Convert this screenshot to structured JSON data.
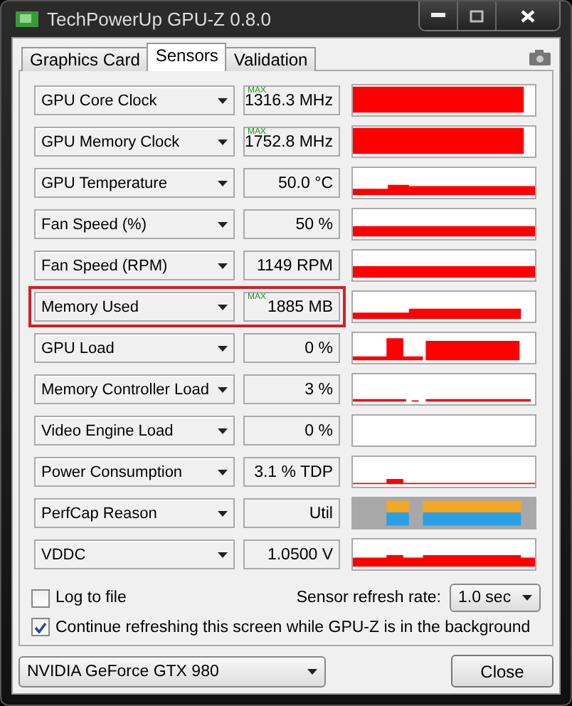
{
  "window": {
    "title": "TechPowerUp GPU-Z 0.8.0"
  },
  "tabs": [
    {
      "label": "Graphics Card",
      "selected": false
    },
    {
      "label": "Sensors",
      "selected": true
    },
    {
      "label": "Validation",
      "selected": false
    }
  ],
  "sensors": [
    {
      "name": "GPU Core Clock",
      "max_label": "MAX",
      "value": "1316.3 MHz",
      "highlighted": false,
      "kind": "line"
    },
    {
      "name": "GPU Memory Clock",
      "max_label": "MAX",
      "value": "1752.8 MHz",
      "highlighted": false,
      "kind": "line"
    },
    {
      "name": "GPU Temperature",
      "value": "50.0 °C",
      "highlighted": false,
      "kind": "line"
    },
    {
      "name": "Fan Speed (%)",
      "value": "50 %",
      "highlighted": false,
      "kind": "line"
    },
    {
      "name": "Fan Speed (RPM)",
      "value": "1149 RPM",
      "highlighted": false,
      "kind": "line"
    },
    {
      "name": "Memory Used",
      "max_label": "MAX",
      "value": "1885 MB",
      "highlighted": true,
      "kind": "line"
    },
    {
      "name": "GPU Load",
      "value": "0 %",
      "highlighted": false,
      "kind": "line"
    },
    {
      "name": "Memory Controller Load",
      "value": "3 %",
      "highlighted": false,
      "kind": "line"
    },
    {
      "name": "Video Engine Load",
      "value": "0 %",
      "highlighted": false,
      "kind": "line"
    },
    {
      "name": "Power Consumption",
      "value": "3.1 % TDP",
      "highlighted": false,
      "kind": "line"
    },
    {
      "name": "PerfCap Reason",
      "value": "Util",
      "highlighted": false,
      "kind": "perfcap"
    },
    {
      "name": "VDDC",
      "value": "1.0500 V",
      "highlighted": false,
      "kind": "line"
    }
  ],
  "options": [
    {
      "label": "Log to file",
      "checked": false
    },
    {
      "label": "Continue refreshing this screen while GPU-Z is in the background",
      "checked": true
    }
  ],
  "refresh": {
    "label": "Sensor refresh rate:",
    "value": "1.0 sec"
  },
  "gpu_select": {
    "value": "NVIDIA GeForce GTX 980"
  },
  "close_button": {
    "label": "Close"
  }
}
